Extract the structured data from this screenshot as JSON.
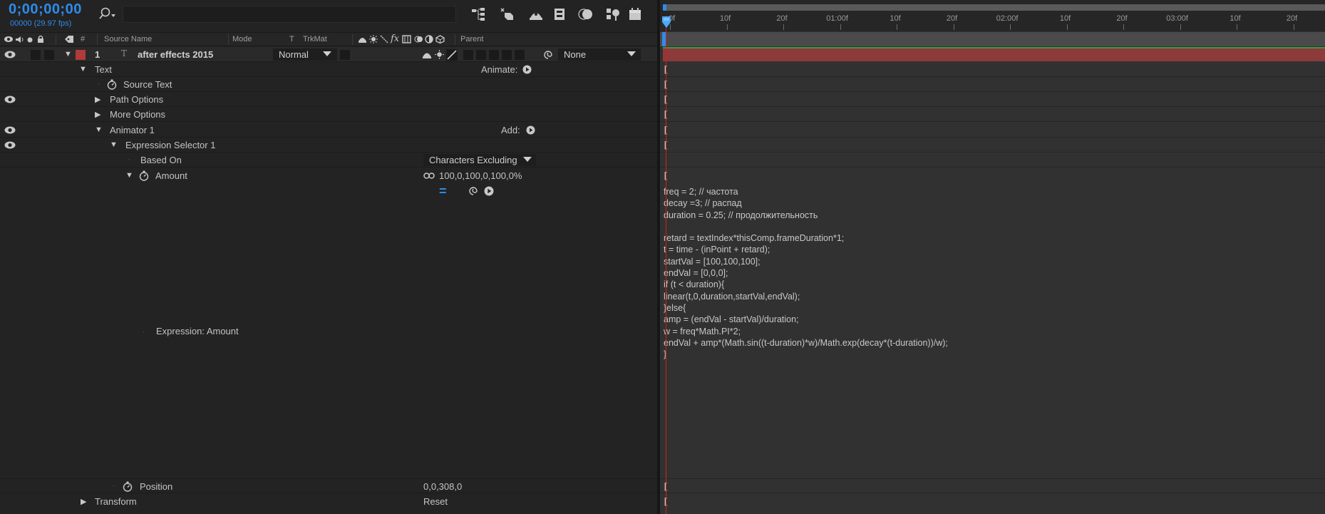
{
  "header": {
    "timecode": "0;00;00;00",
    "fps": "00000 (29.97 fps)"
  },
  "columns": {
    "number": "#",
    "source_name": "Source Name",
    "mode": "Mode",
    "t": "T",
    "trkmat": "TrkMat",
    "fx": "fx",
    "parent": "Parent"
  },
  "layer": {
    "number": "1",
    "name": "after effects 2015",
    "mode": "Normal",
    "parent": "None",
    "label_color": "#b13a3a"
  },
  "properties": {
    "text": "Text",
    "animate_label": "Animate:",
    "source_text": "Source Text",
    "path_options": "Path Options",
    "more_options": "More Options",
    "animator": "Animator 1",
    "add_label": "Add:",
    "expression_selector": "Expression Selector 1",
    "based_on": "Based On",
    "based_on_value": "Characters Excluding",
    "amount": "Amount",
    "amount_value": "100,0,100,0,100,0%",
    "expression_label": "Expression: Amount",
    "expression_equals": "=",
    "position": "Position",
    "position_value": "0,0,308,0",
    "transform": "Transform",
    "transform_value": "Reset"
  },
  "ruler": {
    "ticks": [
      "0f",
      "10f",
      "20f",
      "01:00f",
      "10f",
      "20f",
      "02:00f",
      "10f",
      "20f",
      "03:00f",
      "10f",
      "20f"
    ]
  },
  "expression": {
    "lines": [
      "freq = 2; // частота",
      "decay =3; // распад",
      "duration = 0.25; // продолжительность",
      "",
      "retard = textIndex*thisComp.frameDuration*1;",
      "t = time - (inPoint + retard);",
      "startVal = [100,100,100];",
      "endVal = [0,0,0];",
      "if (t < duration){",
      "linear(t,0,duration,startVal,endVal);",
      "}else{",
      "amp = (endVal - startVal)/duration;",
      "w = freq*Math.PI*2;",
      "endVal + amp*(Math.sin((t-duration)*w)/Math.exp(decay*(t-duration))/w);",
      "}"
    ]
  }
}
